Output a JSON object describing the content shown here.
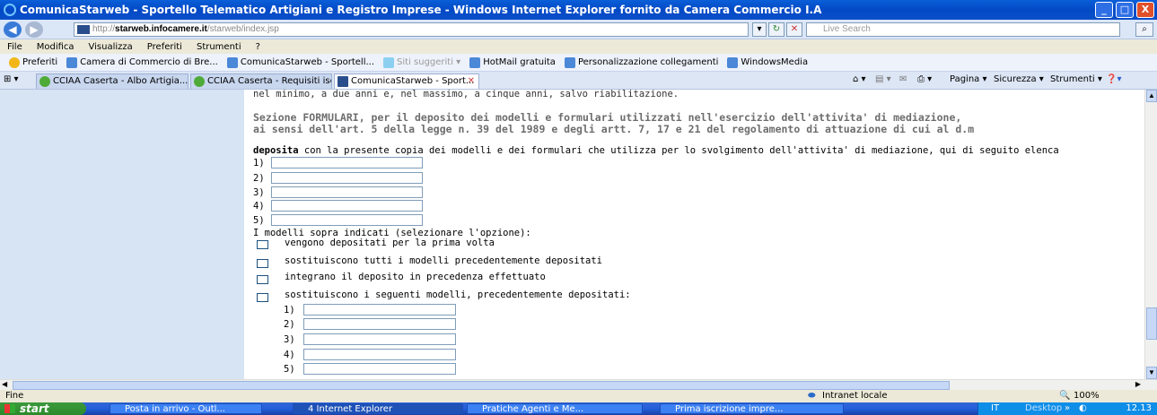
{
  "window": {
    "title": "ComunicaStarweb - Sportello Telematico Artigiani e Registro Imprese - Windows Internet Explorer fornito da Camera Commercio I.A",
    "controls": {
      "minimize": "_",
      "maximize": "□",
      "close": "X"
    }
  },
  "address": {
    "url_prefix": "http://",
    "url_host": "starweb.infocamere.it",
    "url_path": "/starweb/index.jsp",
    "search_placeholder": "Live Search"
  },
  "menu": [
    "File",
    "Modifica",
    "Visualizza",
    "Preferiti",
    "Strumenti",
    "?"
  ],
  "favorites": {
    "label": "Preferiti",
    "items": [
      "Camera di Commercio di Bre...",
      "ComunicaStarweb - Sportell...",
      "Siti suggeriti ▾",
      "HotMail gratuita",
      "Personalizzazione collegamenti",
      "WindowsMedia"
    ]
  },
  "tabs": [
    {
      "label": "CCIAA Caserta - Albo Artigia..."
    },
    {
      "label": "CCIAA Caserta - Requisiti isc..."
    },
    {
      "label": "ComunicaStarweb - Sport...",
      "active": true
    }
  ],
  "commands": {
    "page": "Pagina ▾",
    "security": "Sicurezza ▾",
    "tools": "Strumenti ▾"
  },
  "page": {
    "top_line": "nel minimo, a due anni e, nel massimo, a cinque anni, salvo riabilitazione.",
    "section_line1": "Sezione FORMULARI, per il deposito dei modelli e formulari utilizzati nell'esercizio dell'attivita' di mediazione,",
    "section_line2": "ai sensi dell'art. 5 della legge n. 39 del 1989 e degli artt. 7, 17 e 21 del regolamento di attuazione di cui al d.m",
    "deposita_bold": "deposita",
    "deposita_rest": " con la presente copia dei modelli e dei formulari che utilizza per lo svolgimento dell'attivita' di mediazione, qui di seguito elenca",
    "numbered": [
      "1)",
      "2)",
      "3)",
      "4)",
      "5)"
    ],
    "models_prompt": "I modelli sopra indicati (selezionare l'opzione):",
    "options": [
      "vengono depositati per la prima volta",
      "sostituiscono tutti i modelli precedentemente depositati",
      "integrano il deposito in precedenza effettuato",
      "sostituiscono i seguenti modelli, precedentemente depositati:"
    ],
    "sub_numbered": [
      "1)",
      "2)",
      "3)",
      "4)",
      "5)"
    ]
  },
  "status": {
    "left": "Fine",
    "zone": "Intranet locale",
    "zoom": "100%"
  },
  "taskbar": {
    "start": "start",
    "items": [
      "Posta in arrivo - Outl...",
      "4 Internet Explorer",
      "Pratiche Agenti e Me...",
      "Prima iscrizione impre..."
    ],
    "lang": "IT",
    "desktop": "Desktop",
    "time": "12.13"
  }
}
